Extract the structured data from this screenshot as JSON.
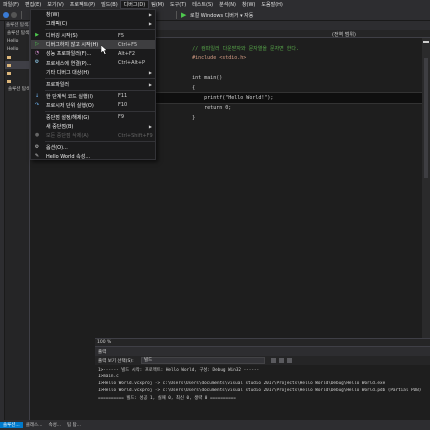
{
  "menubar": [
    "파일(F)",
    "편집(E)",
    "보기(V)",
    "프로젝트(P)",
    "빌드(B)",
    "디버그(D)",
    "팀(M)",
    "도구(T)",
    "테스트(S)",
    "분석(N)",
    "창(W)",
    "도움말(H)"
  ],
  "active_menu": "디버그(D)",
  "toolbar": {
    "run_label": "로컬 Windows 디버거 ▾ 자동",
    "icons": [
      "back-icon",
      "forward-icon",
      "play-icon"
    ]
  },
  "solution_panel": {
    "header": "솔루션 탐색기",
    "rows": [
      "솔루션 탐색기",
      "Hello",
      "Hello",
      "",
      "",
      "",
      "",
      "솔루션 탐색기"
    ]
  },
  "debug_menu": [
    {
      "label": "창(W)",
      "shortcut": "",
      "submenu": true,
      "icon": "",
      "disabled": false
    },
    {
      "label": "그래픽(C)",
      "shortcut": "",
      "submenu": true,
      "icon": "",
      "disabled": false
    },
    {
      "sep": true
    },
    {
      "label": "디버깅 시작(S)",
      "shortcut": "F5",
      "icon": "play-icon",
      "disabled": false
    },
    {
      "label": "디버그하지 않고 시작(H)",
      "shortcut": "Ctrl+F5",
      "icon": "play-outline-icon",
      "hover": true,
      "disabled": false
    },
    {
      "label": "성능 프로파일러(F)...",
      "shortcut": "Alt+F2",
      "icon": "profiler-icon",
      "disabled": false
    },
    {
      "label": "프로세스에 연결(P)...",
      "shortcut": "Ctrl+Alt+P",
      "icon": "attach-icon",
      "disabled": false
    },
    {
      "label": "기타 디버그 대상(H)",
      "shortcut": "",
      "submenu": true,
      "icon": "",
      "disabled": false
    },
    {
      "sep": true
    },
    {
      "label": "프로파일러",
      "shortcut": "",
      "submenu": true,
      "icon": "",
      "disabled": false
    },
    {
      "sep": true
    },
    {
      "label": "한 단계씩 코드 실행(I)",
      "shortcut": "F11",
      "icon": "step-into-icon",
      "disabled": false
    },
    {
      "label": "프로시저 단위 실행(O)",
      "shortcut": "F10",
      "icon": "step-over-icon",
      "disabled": false
    },
    {
      "sep": true
    },
    {
      "label": "중단점 설정/해제(G)",
      "shortcut": "F9",
      "icon": "",
      "disabled": false
    },
    {
      "label": "새 중단점(B)",
      "shortcut": "",
      "submenu": true,
      "icon": "",
      "disabled": false
    },
    {
      "label": "모든 중단점 삭제(A)",
      "shortcut": "Ctrl+Shift+F9",
      "icon": "delete-breakpoints-icon",
      "disabled": true
    },
    {
      "sep": true
    },
    {
      "label": "옵션(O)...",
      "shortcut": "",
      "icon": "gear-icon",
      "disabled": false
    },
    {
      "label": "Hello World 속성...",
      "shortcut": "",
      "icon": "wrench-icon",
      "disabled": false
    }
  ],
  "editor": {
    "scope": "(전역 범위)",
    "lines": [
      {
        "text": "            // 컴파일러 다운받자와 문자열을 문자면 한다.",
        "cls": "cmt"
      },
      {
        "text": "            #include <stdio.h>",
        "cls": "inc"
      },
      {
        "text": "",
        "cls": ""
      },
      {
        "text": "            int main()",
        "cls": ""
      },
      {
        "text": "            {",
        "cls": ""
      },
      {
        "text": "                printf(\"Hello World!\");",
        "cls": "hl"
      },
      {
        "text": "                return 0;",
        "cls": ""
      },
      {
        "text": "            }",
        "cls": ""
      }
    ]
  },
  "zoom": "100 %",
  "output": {
    "title": "출력",
    "source_label": "출력 보기 선택(S):",
    "source_value": "빌드",
    "lines": [
      "1>------ 빌드 시작: 프로젝트: Hello World, 구성: Debug Win32 ------",
      "1>main.c",
      "1>Hello World.vcxproj -> c:\\Users\\Users\\documents\\visual studio 2017\\Projects\\Hello World\\Debug\\Hello World.exe",
      "1>Hello World.vcxproj -> c:\\Users\\Users\\documents\\visual studio 2017\\Projects\\Hello World\\Debug\\Hello World.pdb (Partial PDB)",
      "========== 빌드: 성공 1, 실패 0, 최신 0, 생략 0 =========="
    ]
  },
  "bottom_tabs": [
    "솔루션...",
    "클래스...",
    "속성...",
    "팀 탐..."
  ],
  "colors": {
    "accent": "#007acc",
    "menu_bg": "#1b1b1c",
    "hover": "#3e3e40",
    "play": "#4ec94e"
  }
}
